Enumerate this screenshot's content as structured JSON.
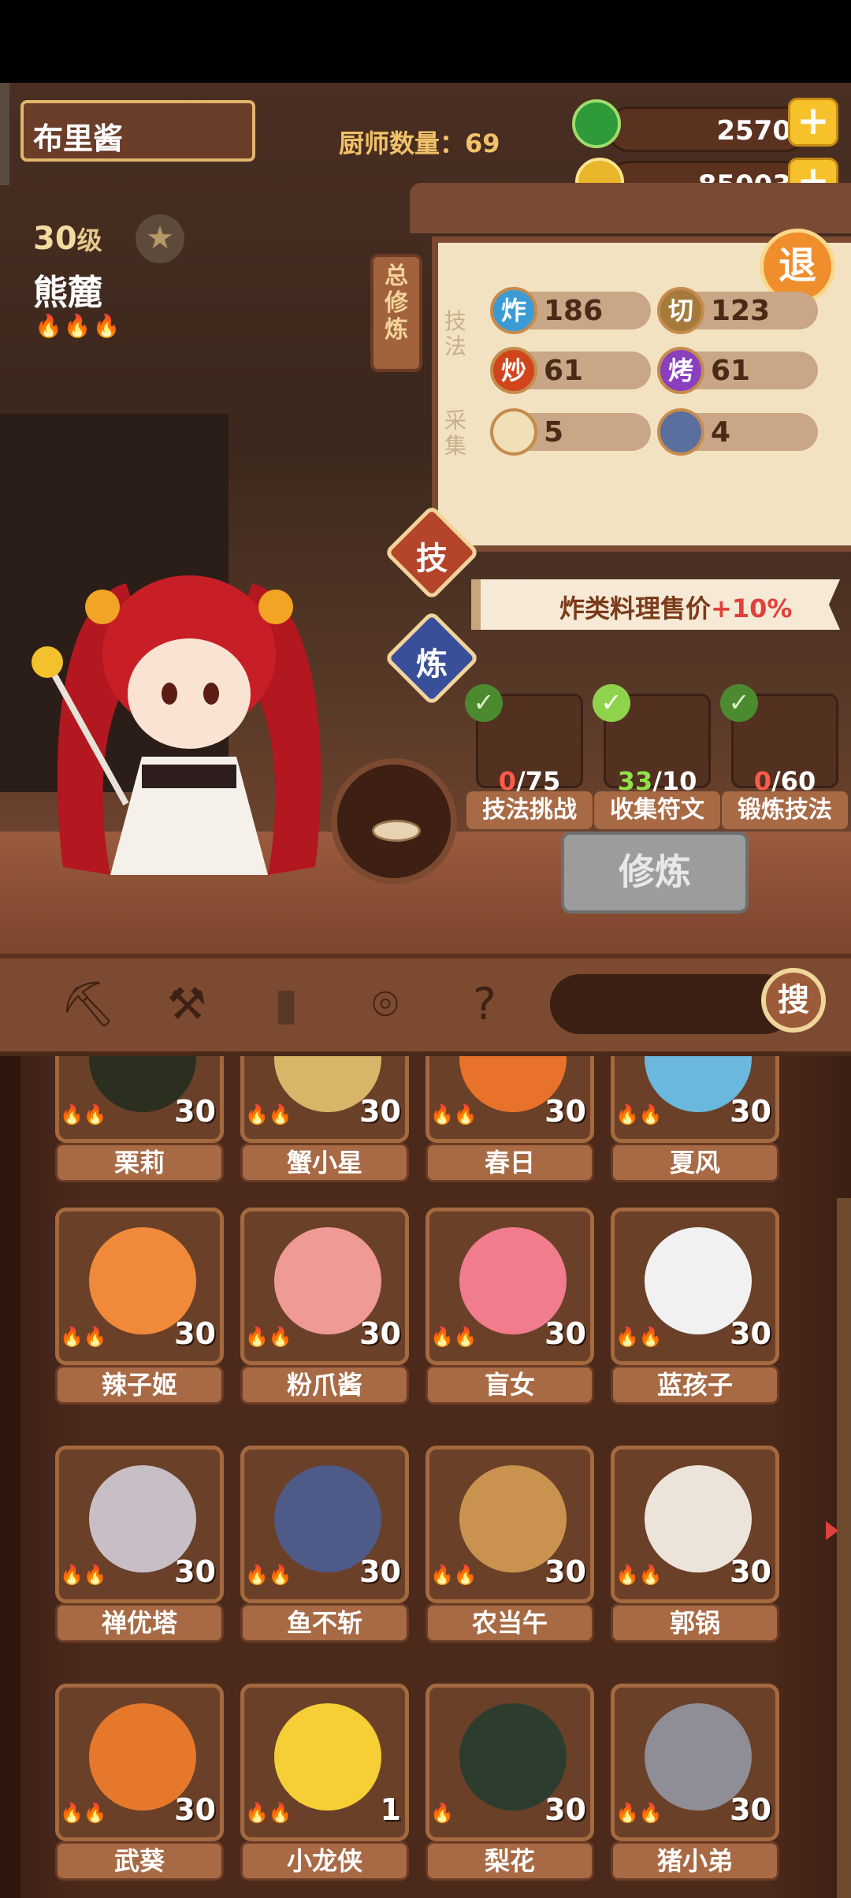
{
  "header": {
    "player_name": "布里酱",
    "chef_count_label": "厨师数量：69",
    "jade_amount": "2570",
    "coin_amount": "85003",
    "plus": "+"
  },
  "chef": {
    "level": "30",
    "level_unit": "级",
    "name": "熊麓",
    "star": "★",
    "flames": "🔥🔥🔥"
  },
  "panel": {
    "tab_label": "总修炼",
    "skill_label": "技法",
    "gather_label": "采集",
    "exit_label": "退",
    "skills": [
      {
        "icon_text": "炸",
        "value": "186",
        "color": "#3a9bd6"
      },
      {
        "icon_text": "切",
        "value": "123",
        "color": "#a57a3a"
      },
      {
        "icon_text": "炒",
        "value": "61",
        "color": "#d0451c"
      },
      {
        "icon_text": "烤",
        "value": "61",
        "color": "#8a3fbf"
      }
    ],
    "gather": [
      {
        "icon_name": "bun-icon",
        "value": "5"
      },
      {
        "icon_name": "fish-icon",
        "value": "4"
      }
    ]
  },
  "modes": {
    "skill_btn": "技",
    "train_btn": "炼"
  },
  "bonus": {
    "text": "炸类料理售价",
    "highlight": "+10%"
  },
  "tasks": [
    {
      "done": "0",
      "total": "75",
      "label": "技法挑战",
      "icon": "crate-icon"
    },
    {
      "done": "33",
      "total": "10",
      "label": "收集符文",
      "icon": "rune-icon"
    },
    {
      "done": "0",
      "total": "60",
      "label": "锻炼技法",
      "icon": "alarm-clock-icon"
    }
  ],
  "cultivate_button": "修炼",
  "search_button": "搜",
  "roster": [
    {
      "name": "栗莉",
      "level": "30"
    },
    {
      "name": "蟹小星",
      "level": "30"
    },
    {
      "name": "春日",
      "level": "30"
    },
    {
      "name": "夏风",
      "level": "30"
    },
    {
      "name": "辣子姬",
      "level": "30"
    },
    {
      "name": "粉爪酱",
      "level": "30"
    },
    {
      "name": "盲女",
      "level": "30"
    },
    {
      "name": "蓝孩子",
      "level": "30"
    },
    {
      "name": "禅优塔",
      "level": "30"
    },
    {
      "name": "鱼不斩",
      "level": "30"
    },
    {
      "name": "农当午",
      "level": "30"
    },
    {
      "name": "郭锅",
      "level": "30"
    },
    {
      "name": "武葵",
      "level": "30"
    },
    {
      "name": "小龙侠",
      "level": "1"
    },
    {
      "name": "梨花",
      "level": "30"
    },
    {
      "name": "猪小弟",
      "level": "30"
    }
  ],
  "colors": {
    "wood": "#7b4a31",
    "accent": "#f7c12c",
    "panel": "#f2e2c2"
  }
}
